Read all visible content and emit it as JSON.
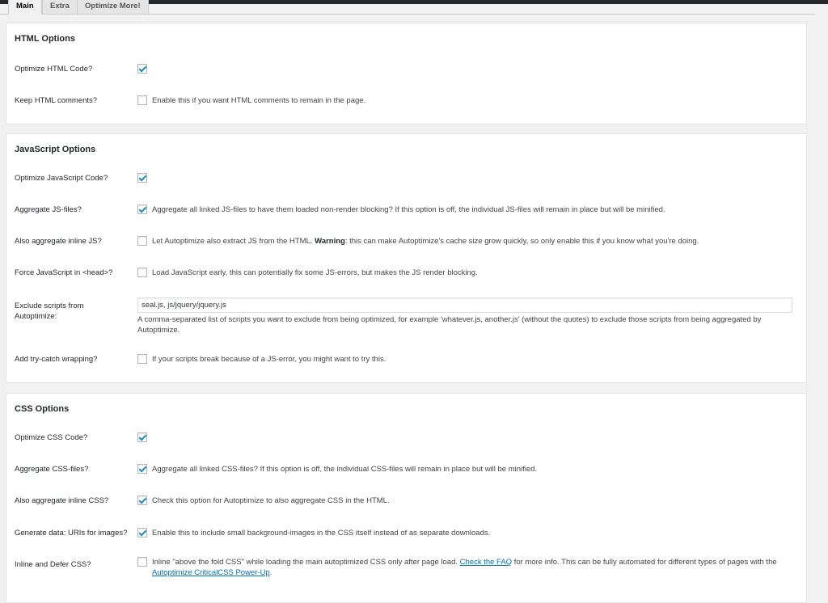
{
  "tabs": [
    {
      "label": "Main",
      "active": true
    },
    {
      "label": "Extra",
      "active": false
    },
    {
      "label": "Optimize More!",
      "active": false
    }
  ],
  "html_options": {
    "title": "HTML Options",
    "rows": [
      {
        "label": "Optimize HTML Code?",
        "checked": true,
        "description": ""
      },
      {
        "label": "Keep HTML comments?",
        "checked": false,
        "description": "Enable this if you want HTML comments to remain in the page."
      }
    ]
  },
  "js_options": {
    "title": "JavaScript Options",
    "optimize": {
      "label": "Optimize JavaScript Code?",
      "checked": true
    },
    "aggregate": {
      "label": "Aggregate JS-files?",
      "checked": true,
      "description": "Aggregate all linked JS-files to have them loaded non-render blocking? If this option is off, the individual JS-files will remain in place but will be minified."
    },
    "inline": {
      "label": "Also aggregate inline JS?",
      "checked": false,
      "desc_before": "Let Autoptimize also extract JS from the HTML. ",
      "desc_bold": "Warning",
      "desc_after": ": this can make Autoptimize's cache size grow quickly, so only enable this if you know what you're doing."
    },
    "force_head": {
      "label": "Force JavaScript in <head>?",
      "checked": false,
      "description": "Load JavaScript early, this can potentially fix some JS-errors, but makes the JS render blocking."
    },
    "exclude": {
      "label": "Exclude scripts from Autoptimize:",
      "value": "seal.js, js/jquery/jquery.js",
      "description": "A comma-separated list of scripts you want to exclude from being optimized, for example 'whatever.js, another.js' (without the quotes) to exclude those scripts from being aggregated by Autoptimize."
    },
    "trycatch": {
      "label": "Add try-catch wrapping?",
      "checked": false,
      "description": "If your scripts break because of a JS-error, you might want to try this."
    }
  },
  "css_options": {
    "title": "CSS Options",
    "optimize": {
      "label": "Optimize CSS Code?",
      "checked": true
    },
    "aggregate": {
      "label": "Aggregate CSS-files?",
      "checked": true,
      "description": "Aggregate all linked CSS-files? If this option is off, the individual CSS-files will remain in place but will be minified."
    },
    "inline": {
      "label": "Also aggregate inline CSS?",
      "checked": true,
      "description": "Check this option for Autoptimize to also aggregate CSS in the HTML."
    },
    "datauris": {
      "label": "Generate data: URIs for images?",
      "checked": true,
      "description": "Enable this to include small background-images in the CSS itself instead of as separate downloads."
    },
    "defer": {
      "label": "Inline and Defer CSS?",
      "checked": false,
      "desc_before": "Inline \"above the fold CSS\" while loading the main autoptimized CSS only after page load. ",
      "faq_link": "Check the FAQ",
      "desc_middle": " for more info. This can be fully automated for different types of pages with the ",
      "powerup_link": "Autoptimize CriticalCSS Power-Up",
      "desc_after": "."
    }
  }
}
